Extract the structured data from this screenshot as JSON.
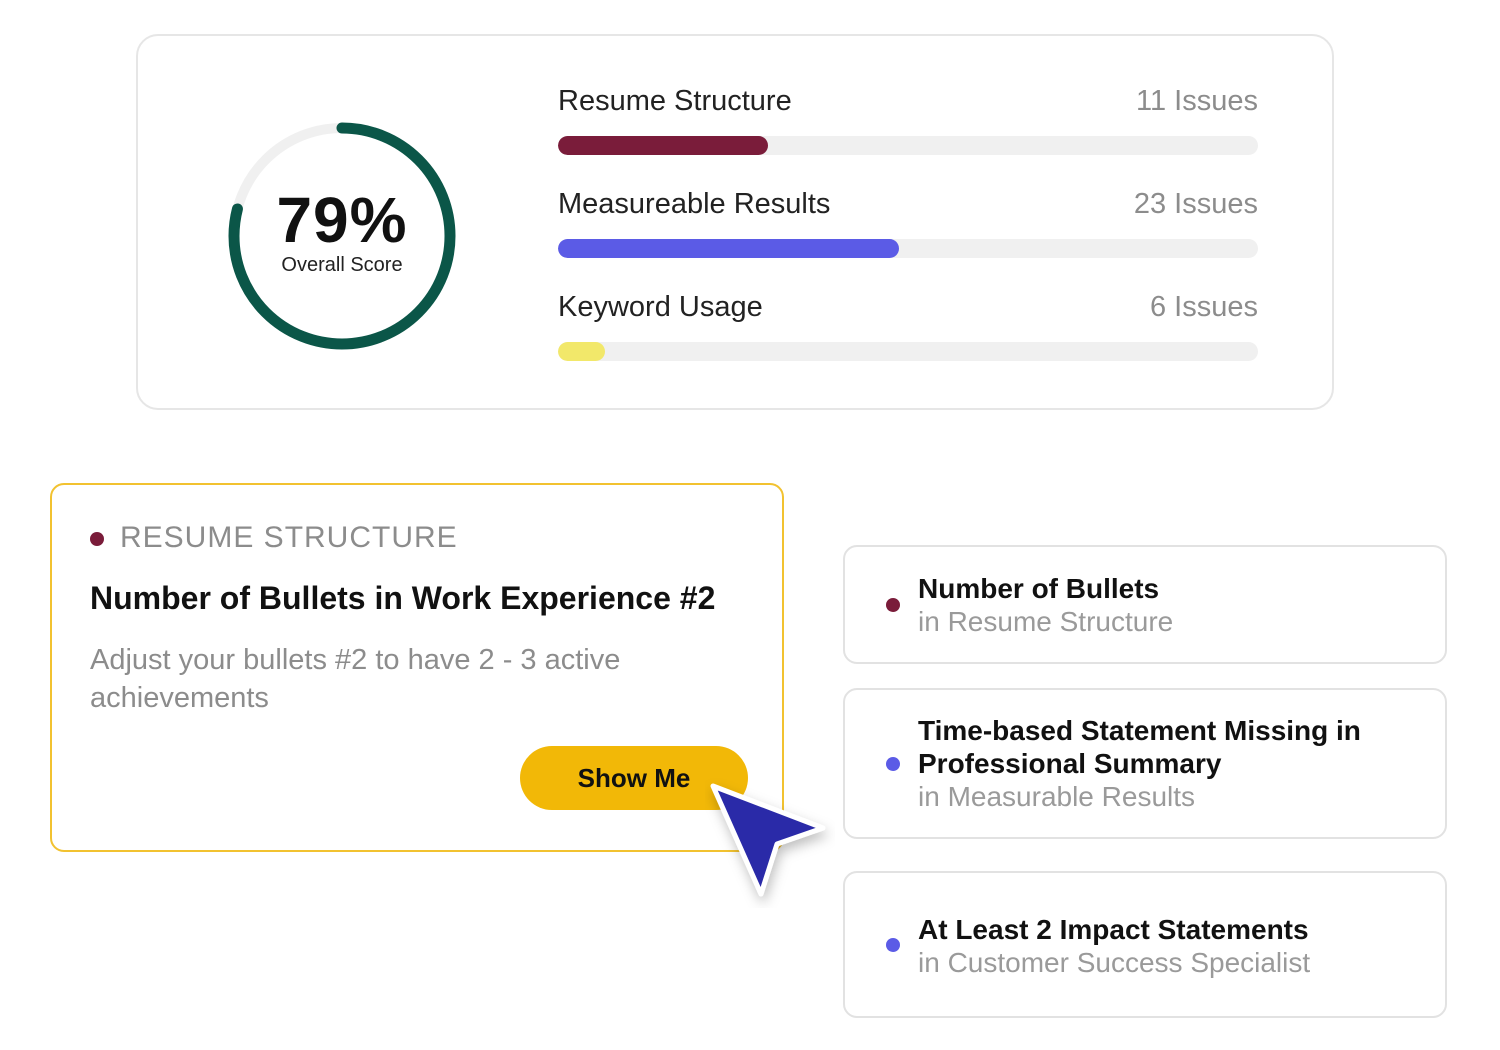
{
  "score": {
    "value": "79%",
    "label": "Overall Score",
    "fraction": 0.79,
    "ring_color": "#0b5648",
    "track_color": "#f0f0f0"
  },
  "metrics": [
    {
      "name": "Resume Structure",
      "count": "11 Issues",
      "fill_fraction": 0.3,
      "color": "#7a1c3a"
    },
    {
      "name": "Measureable Results",
      "count": "23 Issues",
      "fill_fraction": 0.487,
      "color": "#5b5be6"
    },
    {
      "name": "Keyword Usage",
      "count": "6 Issues",
      "fill_fraction": 0.067,
      "color": "#f2e86a"
    }
  ],
  "detail": {
    "category": "RESUME STRUCTURE",
    "category_color": "#7a1c3a",
    "title": "Number of Bullets in Work Experience #2",
    "description": "Adjust your bullets #2 to have 2 - 3 active achievements",
    "button_label": "Show Me",
    "button_color": "#f2b807",
    "border_color": "#f2c230"
  },
  "issues": [
    {
      "title": "Number of Bullets",
      "subtitle": "in Resume Structure",
      "dot_color": "#7a1c3a"
    },
    {
      "title": "Time-based Statement Missing in Professional Summary",
      "subtitle": "in Measurable Results",
      "dot_color": "#5b5be6"
    },
    {
      "title": "At Least 2 Impact Statements",
      "subtitle": "in Customer Success Specialist",
      "dot_color": "#5b5be6"
    }
  ],
  "cursor": {
    "icon": "pointer-arrow-icon",
    "color": "#2a2aa8"
  }
}
